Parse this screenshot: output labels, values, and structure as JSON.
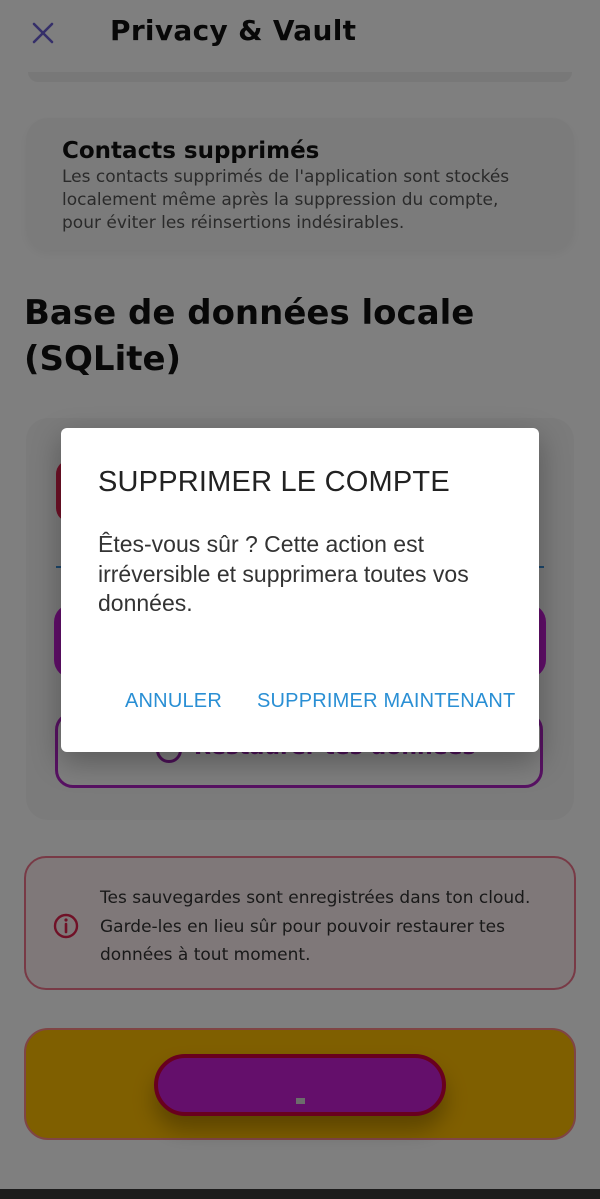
{
  "header": {
    "title": "Privacy & Vault",
    "close_icon": "close-icon",
    "close_color": "#6b5fd3"
  },
  "deleted_contacts": {
    "title": "Contacts supprimés",
    "description": "Les contacts supprimés de l'application sont stockés localement même après la suppression du compte, pour éviter les réinsertions indésirables."
  },
  "database": {
    "section_title": "Base de données locale (SQLite)",
    "restore_label": "Restaurer tes données",
    "restore_icon": "restore-icon"
  },
  "info": {
    "icon": "info-icon",
    "text": "Tes sauvegardes sont enregistrées dans ton cloud. Garde-les en lieu sûr pour pouvoir restaurer tes données à tout moment."
  },
  "dialog": {
    "title": "SUPPRIMER LE COMPTE",
    "message": "Êtes-vous sûr ? Cette action est irréversible et supprimera toutes vos données.",
    "cancel_label": "ANNULER",
    "confirm_label": "SUPPRIMER MAINTENANT",
    "button_color": "#2a8fd4"
  },
  "colors": {
    "accent_purple": "#c51dd6",
    "danger_red": "#e0234e",
    "warning_yellow": "#ffbe00",
    "info_border": "#f0758d"
  }
}
